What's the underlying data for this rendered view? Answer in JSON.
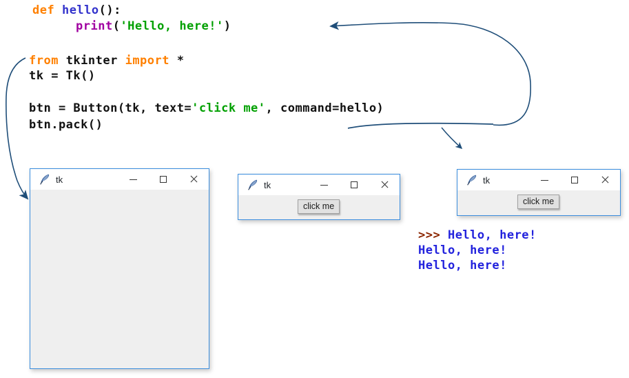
{
  "code": {
    "lines": [
      {
        "id": "def-line",
        "tokens": [
          {
            "t": "def ",
            "c": "kw"
          },
          {
            "t": "hello",
            "c": "fn"
          },
          {
            "t": "():",
            "c": "plain"
          }
        ]
      },
      {
        "id": "print-line",
        "tokens": [
          {
            "t": "print",
            "c": "builtin"
          },
          {
            "t": "(",
            "c": "plain"
          },
          {
            "t": "'Hello, here!'",
            "c": "str"
          },
          {
            "t": ")",
            "c": "plain"
          }
        ]
      },
      {
        "id": "import-line",
        "tokens": [
          {
            "t": "from ",
            "c": "kw"
          },
          {
            "t": "tkinter ",
            "c": "plain"
          },
          {
            "t": "import",
            "c": "kw"
          },
          {
            "t": " *",
            "c": "plain"
          }
        ]
      },
      {
        "id": "tk-line",
        "tokens": [
          {
            "t": "tk = Tk()",
            "c": "plain"
          }
        ]
      },
      {
        "id": "button-line",
        "tokens": [
          {
            "t": "btn = Button(tk, text=",
            "c": "plain"
          },
          {
            "t": "'click me'",
            "c": "str"
          },
          {
            "t": ", command=hello)",
            "c": "plain"
          }
        ]
      },
      {
        "id": "pack-line",
        "tokens": [
          {
            "t": "btn.pack()",
            "c": "plain"
          }
        ]
      }
    ],
    "full_text": "def hello():\n        print('Hello, here!')\n\nfrom tkinter import *\ntk = Tk()\n\nbtn = Button(tk, text='click me', command=hello)\nbtn.pack()",
    "colors": {
      "keyword": "#ff8000",
      "function": "#3333cc",
      "builtin": "#a000a0",
      "string": "#00a000",
      "plain": "#111111"
    }
  },
  "console": {
    "lines": [
      {
        "prompt": ">>> ",
        "text": "Hello, here!"
      },
      {
        "prompt": "",
        "text": "Hello, here!"
      },
      {
        "prompt": "",
        "text": "Hello, here!"
      }
    ],
    "prompt_color": "#8b2500",
    "output_color": "#2222dd"
  },
  "windows": [
    {
      "id": "window-empty",
      "title": "tk",
      "icon": "feather-icon",
      "minimize_label": "—",
      "maximize_label": "□",
      "close_label": "✕",
      "has_button": false,
      "button_label": ""
    },
    {
      "id": "window-with-button",
      "title": "tk",
      "icon": "feather-icon",
      "minimize_label": "—",
      "maximize_label": "□",
      "close_label": "✕",
      "has_button": true,
      "button_label": "click me"
    },
    {
      "id": "window-clicked",
      "title": "tk",
      "icon": "feather-icon",
      "minimize_label": "—",
      "maximize_label": "□",
      "close_label": "✕",
      "has_button": true,
      "button_label": "click me"
    }
  ],
  "annotations": {
    "arrow_color": "#1f4e79",
    "arrows": [
      {
        "name": "command-to-hello-arrow",
        "desc": "from command=hello underline curving up-right then left to the print/def body"
      },
      {
        "name": "code-to-empty-window-arrow",
        "desc": "from the tkinter code block down-left into the empty tk window"
      },
      {
        "name": "code-to-clicked-window-arrow",
        "desc": "short arrow from the underline down to the third tk window"
      }
    ],
    "underline": {
      "name": "command-hello-underline"
    }
  }
}
